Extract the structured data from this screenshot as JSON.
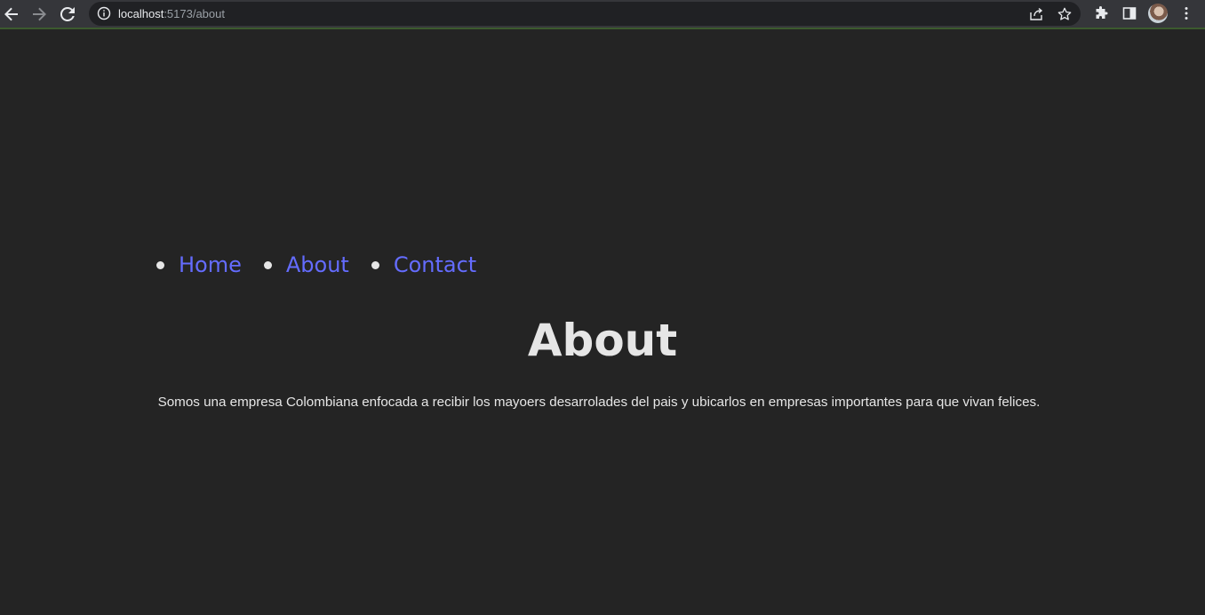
{
  "browser": {
    "url_host": "localhost",
    "url_rest": ":5173/about"
  },
  "nav": {
    "items": [
      {
        "label": "Home"
      },
      {
        "label": "About"
      },
      {
        "label": "Contact"
      }
    ]
  },
  "main": {
    "title": "About",
    "description": "Somos una empresa Colombiana enfocada a recibir los mayoers desarrolades del pais y ubicarlos en empresas importantes para que vivan felices."
  },
  "colors": {
    "background": "#242424",
    "link": "#646cff",
    "text": "#e6e6e6",
    "browser_chrome": "#35363a"
  }
}
